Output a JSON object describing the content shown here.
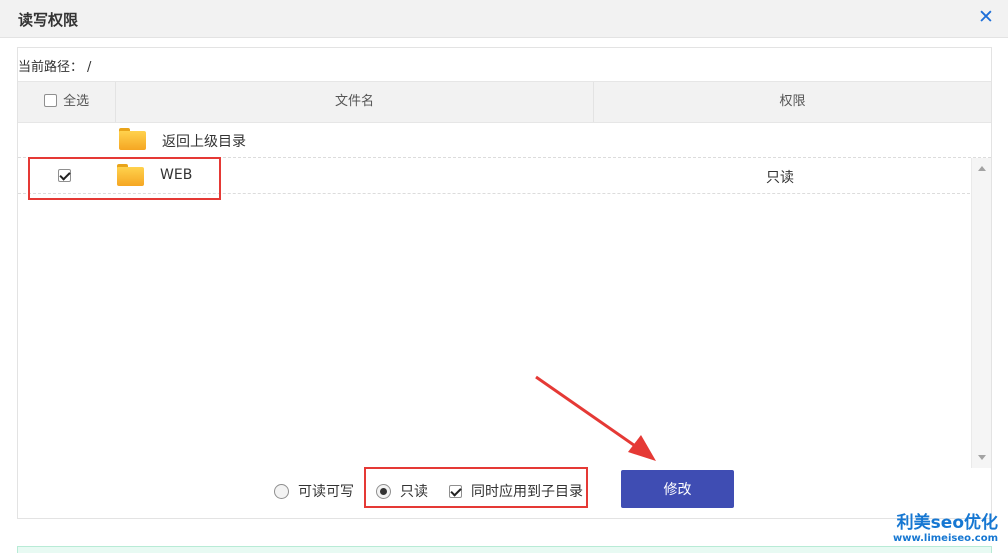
{
  "dialog": {
    "title": "读写权限",
    "close_icon": "close-icon",
    "accent_color": "#1e6fd9"
  },
  "path": {
    "label": "当前路径：",
    "value": "/"
  },
  "table": {
    "select_all_label": "全选",
    "columns": [
      "文件名",
      "权限"
    ],
    "parent_row": {
      "icon": "folder-icon",
      "name": "返回上级目录"
    },
    "rows": [
      {
        "checked": true,
        "icon": "folder-icon",
        "name": "WEB",
        "permission": "只读"
      }
    ]
  },
  "controls": {
    "options": [
      {
        "label": "可读可写",
        "selected": false
      },
      {
        "label": "只读",
        "selected": true
      }
    ],
    "apply_sub_label": "同时应用到子目录",
    "apply_sub_checked": true,
    "modify_button": "修改",
    "button_color": "#3f4db3"
  },
  "annotations": {
    "highlight_color": "#e53935"
  },
  "watermark": {
    "line1": "利美seo优化",
    "line2": "www.limeiseo.com"
  }
}
